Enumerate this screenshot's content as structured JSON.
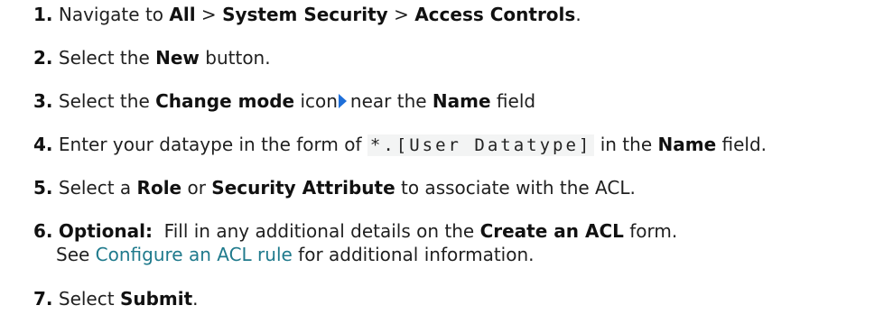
{
  "steps": [
    {
      "num": "1.",
      "t1": "Navigate to ",
      "b1": "All",
      "t2": " > ",
      "b2": "System Security",
      "t3": " > ",
      "b3": "Access Controls",
      "t4": "."
    },
    {
      "num": "2.",
      "t1": "Select the ",
      "b1": "New",
      "t2": " button."
    },
    {
      "num": "3.",
      "t1": "Select the ",
      "b1": "Change mode",
      "t2": " icon",
      "icon": "play-triangle-icon",
      "t3": "near the ",
      "b2": "Name",
      "t4": " field"
    },
    {
      "num": "4.",
      "t1": "Enter your dataype in the form of ",
      "code": "*.[User Datatype]",
      "t2": " in the ",
      "b1": "Name",
      "t3": " field."
    },
    {
      "num": "5.",
      "t1": "Select a ",
      "b1": "Role",
      "t2": " or ",
      "b2": "Security Attribute",
      "t3": " to associate with the ACL."
    },
    {
      "num": "6.",
      "b1": "Optional:",
      "t1": "  Fill in any additional details on the ",
      "b2": "Create an ACL",
      "t2": " form.",
      "t3": "See ",
      "link": "Configure an ACL rule",
      "t4": " for additional information."
    },
    {
      "num": "7.",
      "t1": "Select ",
      "b1": "Submit",
      "t2": "."
    }
  ],
  "colors": {
    "link": "#1f7a8c",
    "icon": "#1e6fd9",
    "text": "#1f1f1f"
  }
}
